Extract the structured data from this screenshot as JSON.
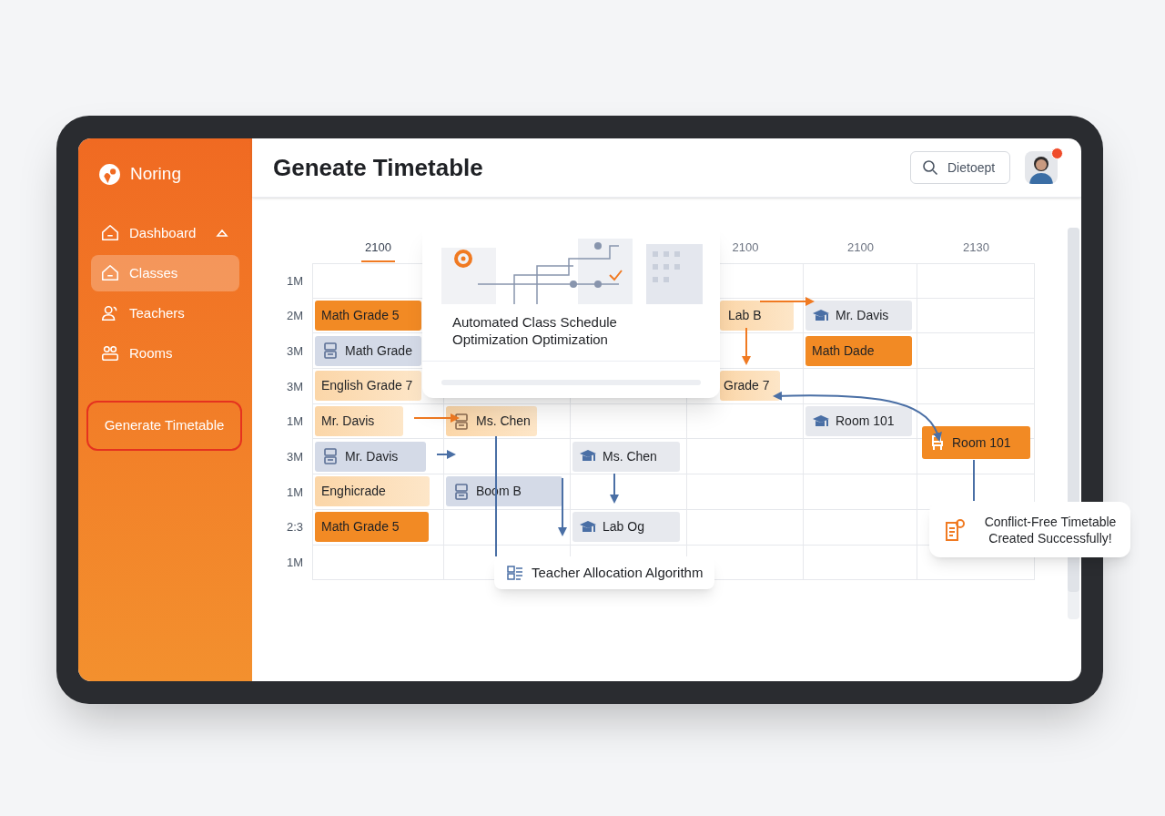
{
  "app": {
    "name": "Noring"
  },
  "sidebar": {
    "items": [
      {
        "label": "Dashboard",
        "kind": "home",
        "expanded": true,
        "selected": false
      },
      {
        "label": "Classes",
        "kind": "home",
        "selected": true
      },
      {
        "label": "Teachers",
        "kind": "people",
        "selected": false
      },
      {
        "label": "Rooms",
        "kind": "rooms",
        "selected": false
      }
    ],
    "action": "Generate Timetable"
  },
  "header": {
    "title": "Geneate Timetable",
    "search": {
      "placeholder": "Dietoept"
    },
    "unread": true
  },
  "timetable": {
    "time_labels": [
      {
        "label": "2100",
        "selected": true
      },
      {
        "label": "2100",
        "selected": false
      },
      {
        "label": "2100",
        "selected": false
      },
      {
        "label": "2130",
        "selected": false
      }
    ],
    "rows": [
      {
        "label": "1M",
        "cells": [
          {
            "kind": "empty"
          },
          {
            "kind": "empty"
          },
          {
            "kind": "empty"
          },
          {
            "kind": "empty"
          },
          {
            "kind": "empty"
          },
          {
            "kind": "empty"
          }
        ]
      },
      {
        "label": "2M",
        "cells": [
          {
            "kind": "solid",
            "title": "Math Grade 5",
            "icon": false
          },
          {
            "kind": "empty"
          },
          {
            "kind": "empty"
          },
          {
            "kind": "light",
            "title": "Lab B",
            "icon": false
          },
          {
            "kind": "gray",
            "title": "Mr. Davis",
            "icon": true
          },
          {
            "kind": "empty"
          }
        ]
      },
      {
        "label": "3M",
        "cells": [
          {
            "kind": "slate",
            "title": "Math Grade",
            "icon": true
          },
          {
            "kind": "empty"
          },
          {
            "kind": "empty"
          },
          {
            "kind": "empty"
          },
          {
            "kind": "solid",
            "title": "Math Dade",
            "icon": false
          },
          {
            "kind": "empty"
          }
        ]
      },
      {
        "label": "3M",
        "cells": [
          {
            "kind": "light",
            "title": "English Grade 7",
            "icon": false
          },
          {
            "kind": "empty"
          },
          {
            "kind": "empty"
          },
          {
            "kind": "light",
            "title": "Grade 7",
            "icon": false
          },
          {
            "kind": "empty"
          },
          {
            "kind": "empty"
          }
        ]
      },
      {
        "label": "1M",
        "cells": [
          {
            "kind": "light",
            "title": "Mr. Davis",
            "icon": false
          },
          {
            "kind": "light",
            "title": "Ms. Chen",
            "icon": true
          },
          {
            "kind": "empty"
          },
          {
            "kind": "empty"
          },
          {
            "kind": "gray",
            "title": "Room 101",
            "icon": true
          },
          {
            "kind": "empty"
          }
        ]
      },
      {
        "label": "3M",
        "cells": [
          {
            "kind": "slate",
            "title": "Mr. Davis",
            "icon": true
          },
          {
            "kind": "empty"
          },
          {
            "kind": "gray",
            "title": "Ms. Chen",
            "icon": true
          },
          {
            "kind": "empty"
          },
          {
            "kind": "empty"
          },
          {
            "kind": "solid",
            "title": "Room 101",
            "icon": true
          }
        ]
      },
      {
        "label": "1M",
        "cells": [
          {
            "kind": "light",
            "title": "Enghicrade",
            "icon": false
          },
          {
            "kind": "slate",
            "title": "Boom B",
            "icon": true
          },
          {
            "kind": "empty"
          },
          {
            "kind": "empty"
          },
          {
            "kind": "empty"
          },
          {
            "kind": "empty"
          }
        ]
      },
      {
        "label": "2:3",
        "cells": [
          {
            "kind": "solid",
            "title": "Math Grade 5",
            "icon": false
          },
          {
            "kind": "empty"
          },
          {
            "kind": "gray",
            "title": "Lab Og",
            "icon": true
          },
          {
            "kind": "empty"
          },
          {
            "kind": "empty"
          },
          {
            "kind": "empty"
          }
        ]
      },
      {
        "label": "1M",
        "cells": [
          {
            "kind": "empty"
          },
          {
            "kind": "empty"
          },
          {
            "kind": "empty"
          },
          {
            "kind": "empty"
          },
          {
            "kind": "empty"
          },
          {
            "kind": "empty"
          }
        ]
      }
    ]
  },
  "overlay_card": {
    "title": "Automated Class Schedule Optimization Optimization"
  },
  "algorithm_label": "Teacher Allocation Algorithm",
  "toast": {
    "message": "Conflict-Free Timetable Created Successfully!"
  }
}
